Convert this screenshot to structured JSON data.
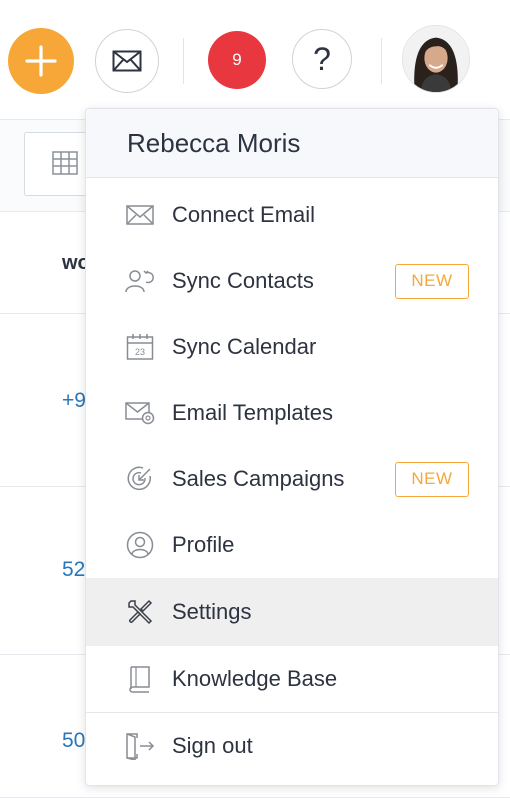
{
  "topbar": {
    "add_icon": "plus-icon",
    "mail_icon": "envelope-icon",
    "notification_count": "9",
    "help_label": "?",
    "avatar_icon": "user-avatar"
  },
  "background": {
    "header_partial": "wo",
    "rows": [
      "+9",
      "52",
      "50"
    ]
  },
  "dropdown": {
    "user_name": "Rebecca Moris",
    "items": [
      {
        "label": "Connect Email",
        "icon": "envelope-icon"
      },
      {
        "label": "Sync Contacts",
        "icon": "sync-contacts-icon",
        "badge": "NEW"
      },
      {
        "label": "Sync Calendar",
        "icon": "calendar-icon"
      },
      {
        "label": "Email Templates",
        "icon": "email-template-icon"
      },
      {
        "label": "Sales Campaigns",
        "icon": "target-icon",
        "badge": "NEW"
      },
      {
        "label": "Profile",
        "icon": "profile-icon"
      },
      {
        "label": "Settings",
        "icon": "wrench-screwdriver-icon"
      },
      {
        "label": "Knowledge Base",
        "icon": "book-icon"
      },
      {
        "label": "Sign out",
        "icon": "sign-out-icon"
      }
    ]
  },
  "colors": {
    "accent_orange": "#f7a738",
    "notification_red": "#e8373f",
    "link_blue": "#2a76b9",
    "badge_orange": "#f6a83b"
  }
}
